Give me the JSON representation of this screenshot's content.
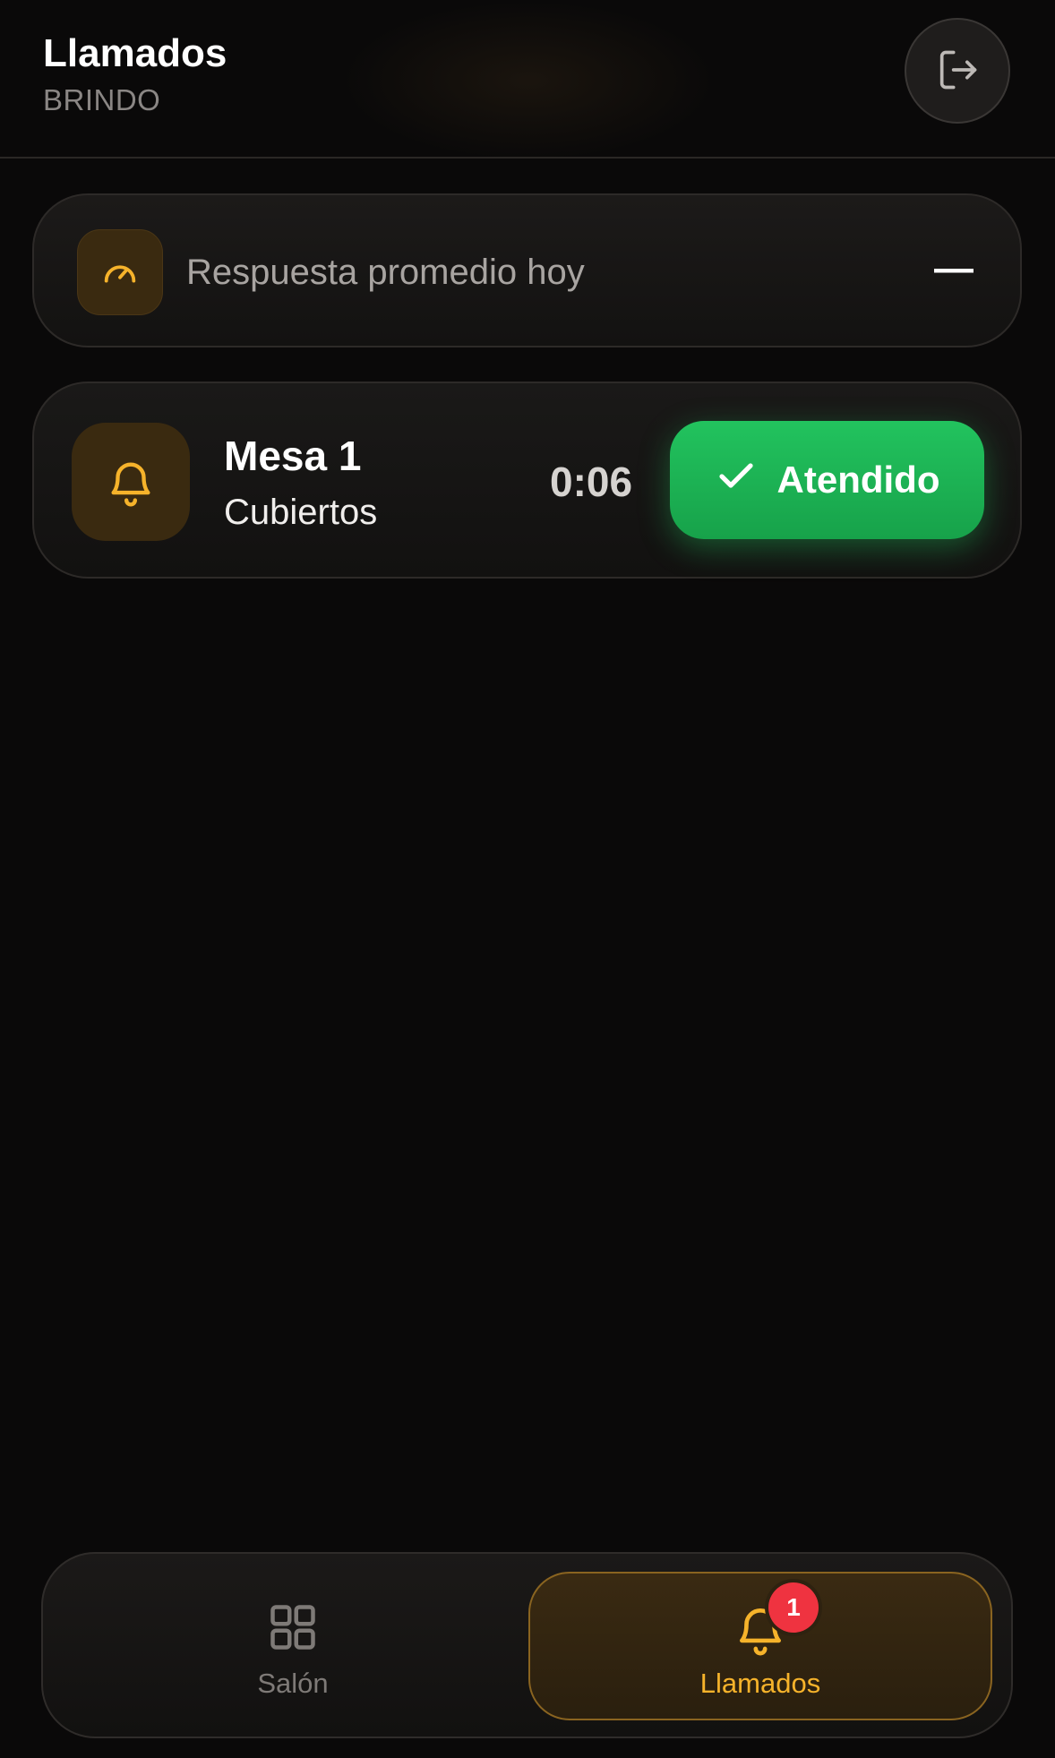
{
  "header": {
    "title": "Llamados",
    "subtitle": "BRINDO",
    "logout_icon": "logout-icon"
  },
  "stats": {
    "icon": "gauge-icon",
    "label": "Respuesta promedio hoy",
    "value": "—"
  },
  "calls": [
    {
      "icon": "bell-icon",
      "table": "Mesa 1",
      "reason": "Cubiertos",
      "elapsed": "0:06",
      "action_label": "Atendido",
      "action_icon": "check-icon"
    }
  ],
  "nav": {
    "tabs": [
      {
        "label": "Salón",
        "icon": "grid-icon",
        "active": false
      },
      {
        "label": "Llamados",
        "icon": "bell-icon",
        "active": true,
        "badge": "1"
      }
    ]
  },
  "colors": {
    "background": "#0a0909",
    "accent": "#f6b32b",
    "success": "#22c35e",
    "badge": "#ef3340"
  }
}
